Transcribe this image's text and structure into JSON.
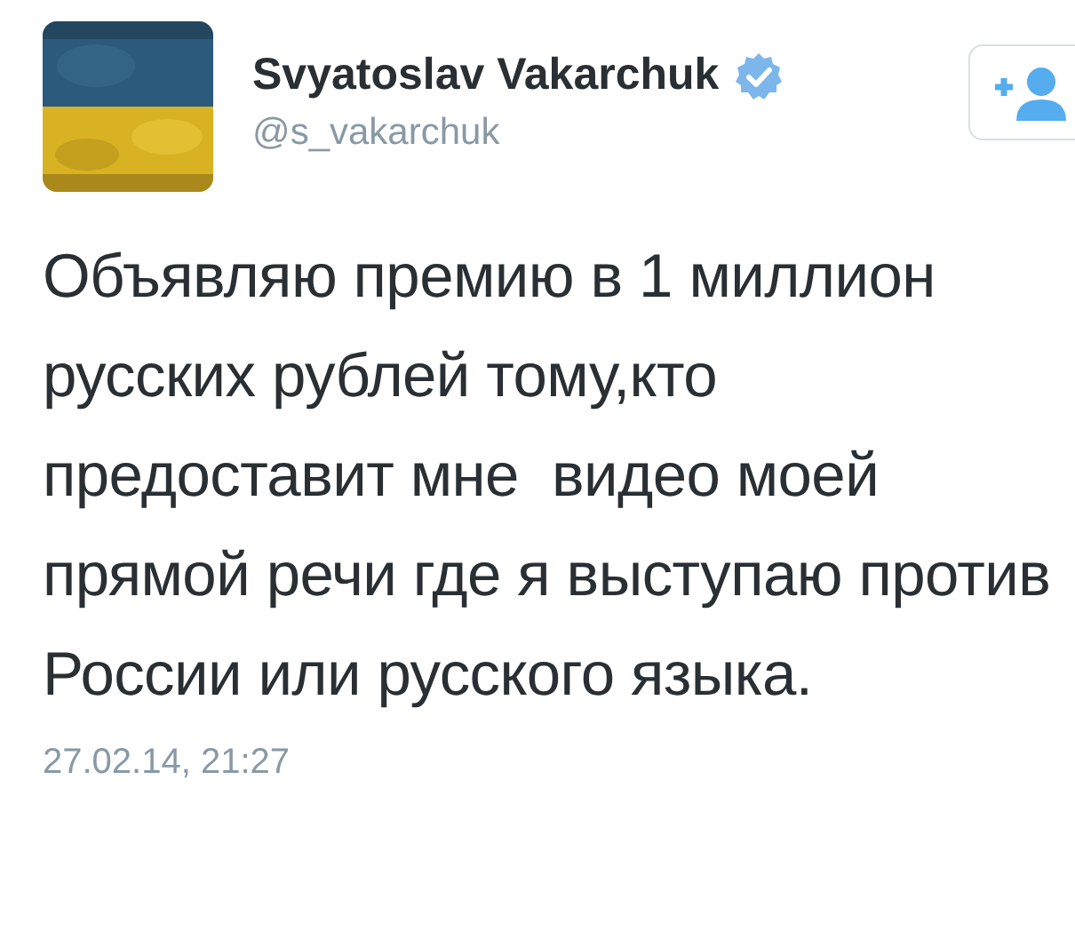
{
  "author": {
    "name": "Svyatoslav Vakarchuk",
    "verified": true,
    "handle": "@s_vakarchuk"
  },
  "tweet": {
    "text": "Объявляю премию в 1 миллион русских рублей тому,кто предоставит мне  видео моей прямой речи где я выступаю против России или русского языка.",
    "timestamp": "27.02.14, 21:27"
  }
}
